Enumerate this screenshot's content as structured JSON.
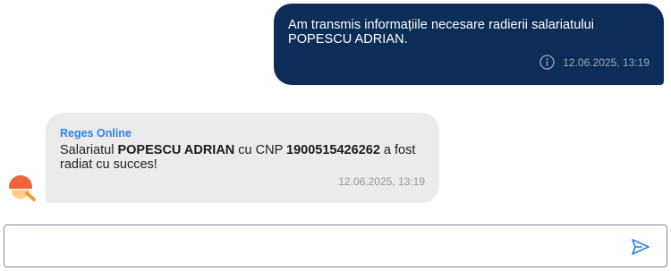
{
  "outgoing_message": {
    "text": "Am transmis informațiile necesare radierii salariatului POPESCU ADRIAN.",
    "timestamp": "12.06.2025, 13:19",
    "info_icon": "info-icon",
    "bubble_color": "#0b2d57"
  },
  "incoming_message": {
    "sender": "Reges Online",
    "text_parts": {
      "p1": "Salariatul ",
      "name": "POPESCU ADRIAN",
      "p2": " cu CNP ",
      "cnp": "1900515426262",
      "p3": " a fost radiat cu succes!"
    },
    "timestamp": "12.06.2025, 13:19",
    "sender_color": "#2c83e9",
    "bubble_color": "#ebebeb"
  },
  "avatar": {
    "icon": "bot-avatar-icon"
  },
  "composer": {
    "value": "",
    "placeholder": "",
    "send_icon": "send-icon",
    "accent": "#2c83e9"
  }
}
